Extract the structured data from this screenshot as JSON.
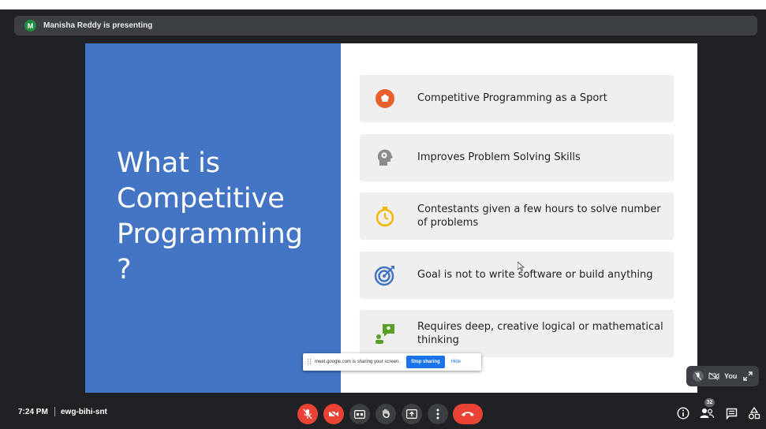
{
  "presenter": {
    "avatar_initial": "M",
    "text": "Manisha Reddy is presenting"
  },
  "slide": {
    "title": "What is\nCompetitive\nProgramming\n?",
    "items": [
      {
        "text": "Competitive Programming as a Sport",
        "icon": "soccer-ball-icon",
        "color": "#e8612c"
      },
      {
        "text": "Improves Problem Solving Skills",
        "icon": "head-gears-icon",
        "color": "#8c8c8c"
      },
      {
        "text": "Contestants given a few hours to solve number of problems",
        "icon": "stopwatch-icon",
        "color": "#f3b400"
      },
      {
        "text": "Goal is not to write software or build anything",
        "icon": "target-icon",
        "color": "#4474c4"
      },
      {
        "text": "Requires deep, creative logical or mathematical thinking",
        "icon": "idea-presenter-icon",
        "color": "#5aa028"
      }
    ]
  },
  "share_banner": {
    "message": "meet.google.com is sharing your screen.",
    "stop_label": "Stop sharing",
    "hide_label": "Hide"
  },
  "self_tile": {
    "label": "You"
  },
  "bottom_bar": {
    "time": "7:24 PM",
    "meeting_code": "ewg-bihi-snt",
    "participants_count": "32"
  },
  "colors": {
    "background": "#202124",
    "slide_blue": "#4474c4",
    "danger": "#ea4335",
    "accent": "#1a73e8"
  }
}
